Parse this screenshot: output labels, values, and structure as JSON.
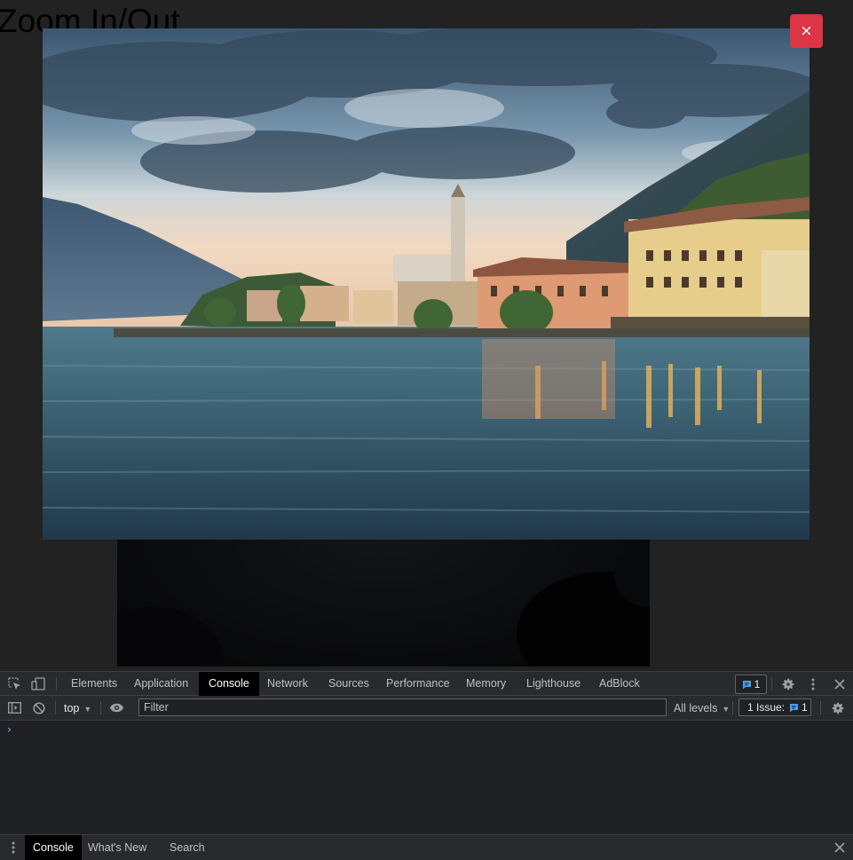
{
  "page": {
    "heading": "Zoom In/Out"
  },
  "modal": {
    "close_label": "×",
    "close_color": "#dc3545"
  },
  "devtools": {
    "tabs": [
      {
        "label": "Elements",
        "active": false
      },
      {
        "label": "Application",
        "active": false
      },
      {
        "label": "Console",
        "active": true
      },
      {
        "label": "Network",
        "active": false
      },
      {
        "label": "Sources",
        "active": false
      },
      {
        "label": "Performance",
        "active": false
      },
      {
        "label": "Memory",
        "active": false
      },
      {
        "label": "Lighthouse",
        "active": false
      },
      {
        "label": "AdBlock",
        "active": false
      }
    ],
    "messages_badge": "1",
    "toolbar": {
      "context": "top",
      "filter_placeholder": "Filter",
      "levels": "All levels",
      "issues_label": "1 Issue:",
      "issues_count": "1"
    },
    "console": {
      "prompt": "›"
    },
    "drawer": {
      "tabs": [
        {
          "label": "Console",
          "active": true
        },
        {
          "label": "What's New",
          "active": false
        },
        {
          "label": "Search",
          "active": false
        }
      ]
    },
    "icons": {
      "inspect": "inspect-element-icon",
      "device": "device-toolbar-icon",
      "settings": "gear-icon",
      "more": "kebab-menu-icon",
      "close": "close-icon",
      "sidebar": "console-sidebar-icon",
      "clear": "clear-console-icon",
      "eye": "live-expression-icon",
      "message": "message-icon"
    },
    "accent_color": "#4d9ef5"
  }
}
